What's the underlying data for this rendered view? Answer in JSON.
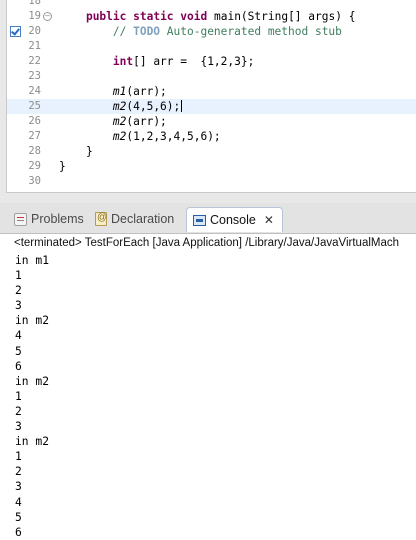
{
  "editor": {
    "lines": [
      {
        "num": "18",
        "segments": []
      },
      {
        "num": "19",
        "fold": "−",
        "segments": [
          {
            "t": "    "
          },
          {
            "t": "public",
            "c": "kw"
          },
          {
            "t": " "
          },
          {
            "t": "static",
            "c": "kw"
          },
          {
            "t": " "
          },
          {
            "t": "void",
            "c": "kw"
          },
          {
            "t": " main(String[] args) {"
          }
        ]
      },
      {
        "num": "20",
        "todo": true,
        "segments": [
          {
            "t": "        // ",
            "c": "cm"
          },
          {
            "t": "TODO",
            "c": "todo"
          },
          {
            "t": " Auto-generated method stub",
            "c": "cm"
          }
        ]
      },
      {
        "num": "21",
        "segments": []
      },
      {
        "num": "22",
        "segments": [
          {
            "t": "        "
          },
          {
            "t": "int",
            "c": "kw"
          },
          {
            "t": "[] arr =  {1,2,3};"
          }
        ]
      },
      {
        "num": "23",
        "segments": []
      },
      {
        "num": "24",
        "segments": [
          {
            "t": "        "
          },
          {
            "t": "m1",
            "c": "it"
          },
          {
            "t": "(arr);"
          }
        ]
      },
      {
        "num": "25",
        "current": true,
        "segments": [
          {
            "t": "        "
          },
          {
            "t": "m2",
            "c": "it"
          },
          {
            "t": "(4,5,6);"
          }
        ]
      },
      {
        "num": "26",
        "segments": [
          {
            "t": "        "
          },
          {
            "t": "m2",
            "c": "it"
          },
          {
            "t": "(arr);"
          }
        ]
      },
      {
        "num": "27",
        "segments": [
          {
            "t": "        "
          },
          {
            "t": "m2",
            "c": "it"
          },
          {
            "t": "(1,2,3,4,5,6);"
          }
        ]
      },
      {
        "num": "28",
        "segments": [
          {
            "t": "    }"
          }
        ]
      },
      {
        "num": "29",
        "segments": [
          {
            "t": "}"
          }
        ]
      },
      {
        "num": "30",
        "segments": []
      }
    ]
  },
  "tabs": {
    "problems": "Problems",
    "declaration": "Declaration",
    "console": "Console",
    "close": "✕"
  },
  "console": {
    "header": "<terminated> TestForEach [Java Application] /Library/Java/JavaVirtualMach",
    "output": [
      "in m1",
      "1",
      "2",
      "3",
      "in m2",
      "4",
      "5",
      "6",
      "in m2",
      "1",
      "2",
      "3",
      "in m2",
      "1",
      "2",
      "3",
      "4",
      "5",
      "6"
    ]
  },
  "icons": {
    "problems": "problems-icon",
    "declaration": "declaration-icon",
    "console": "console-icon",
    "todo": "task-checkbox-icon"
  }
}
